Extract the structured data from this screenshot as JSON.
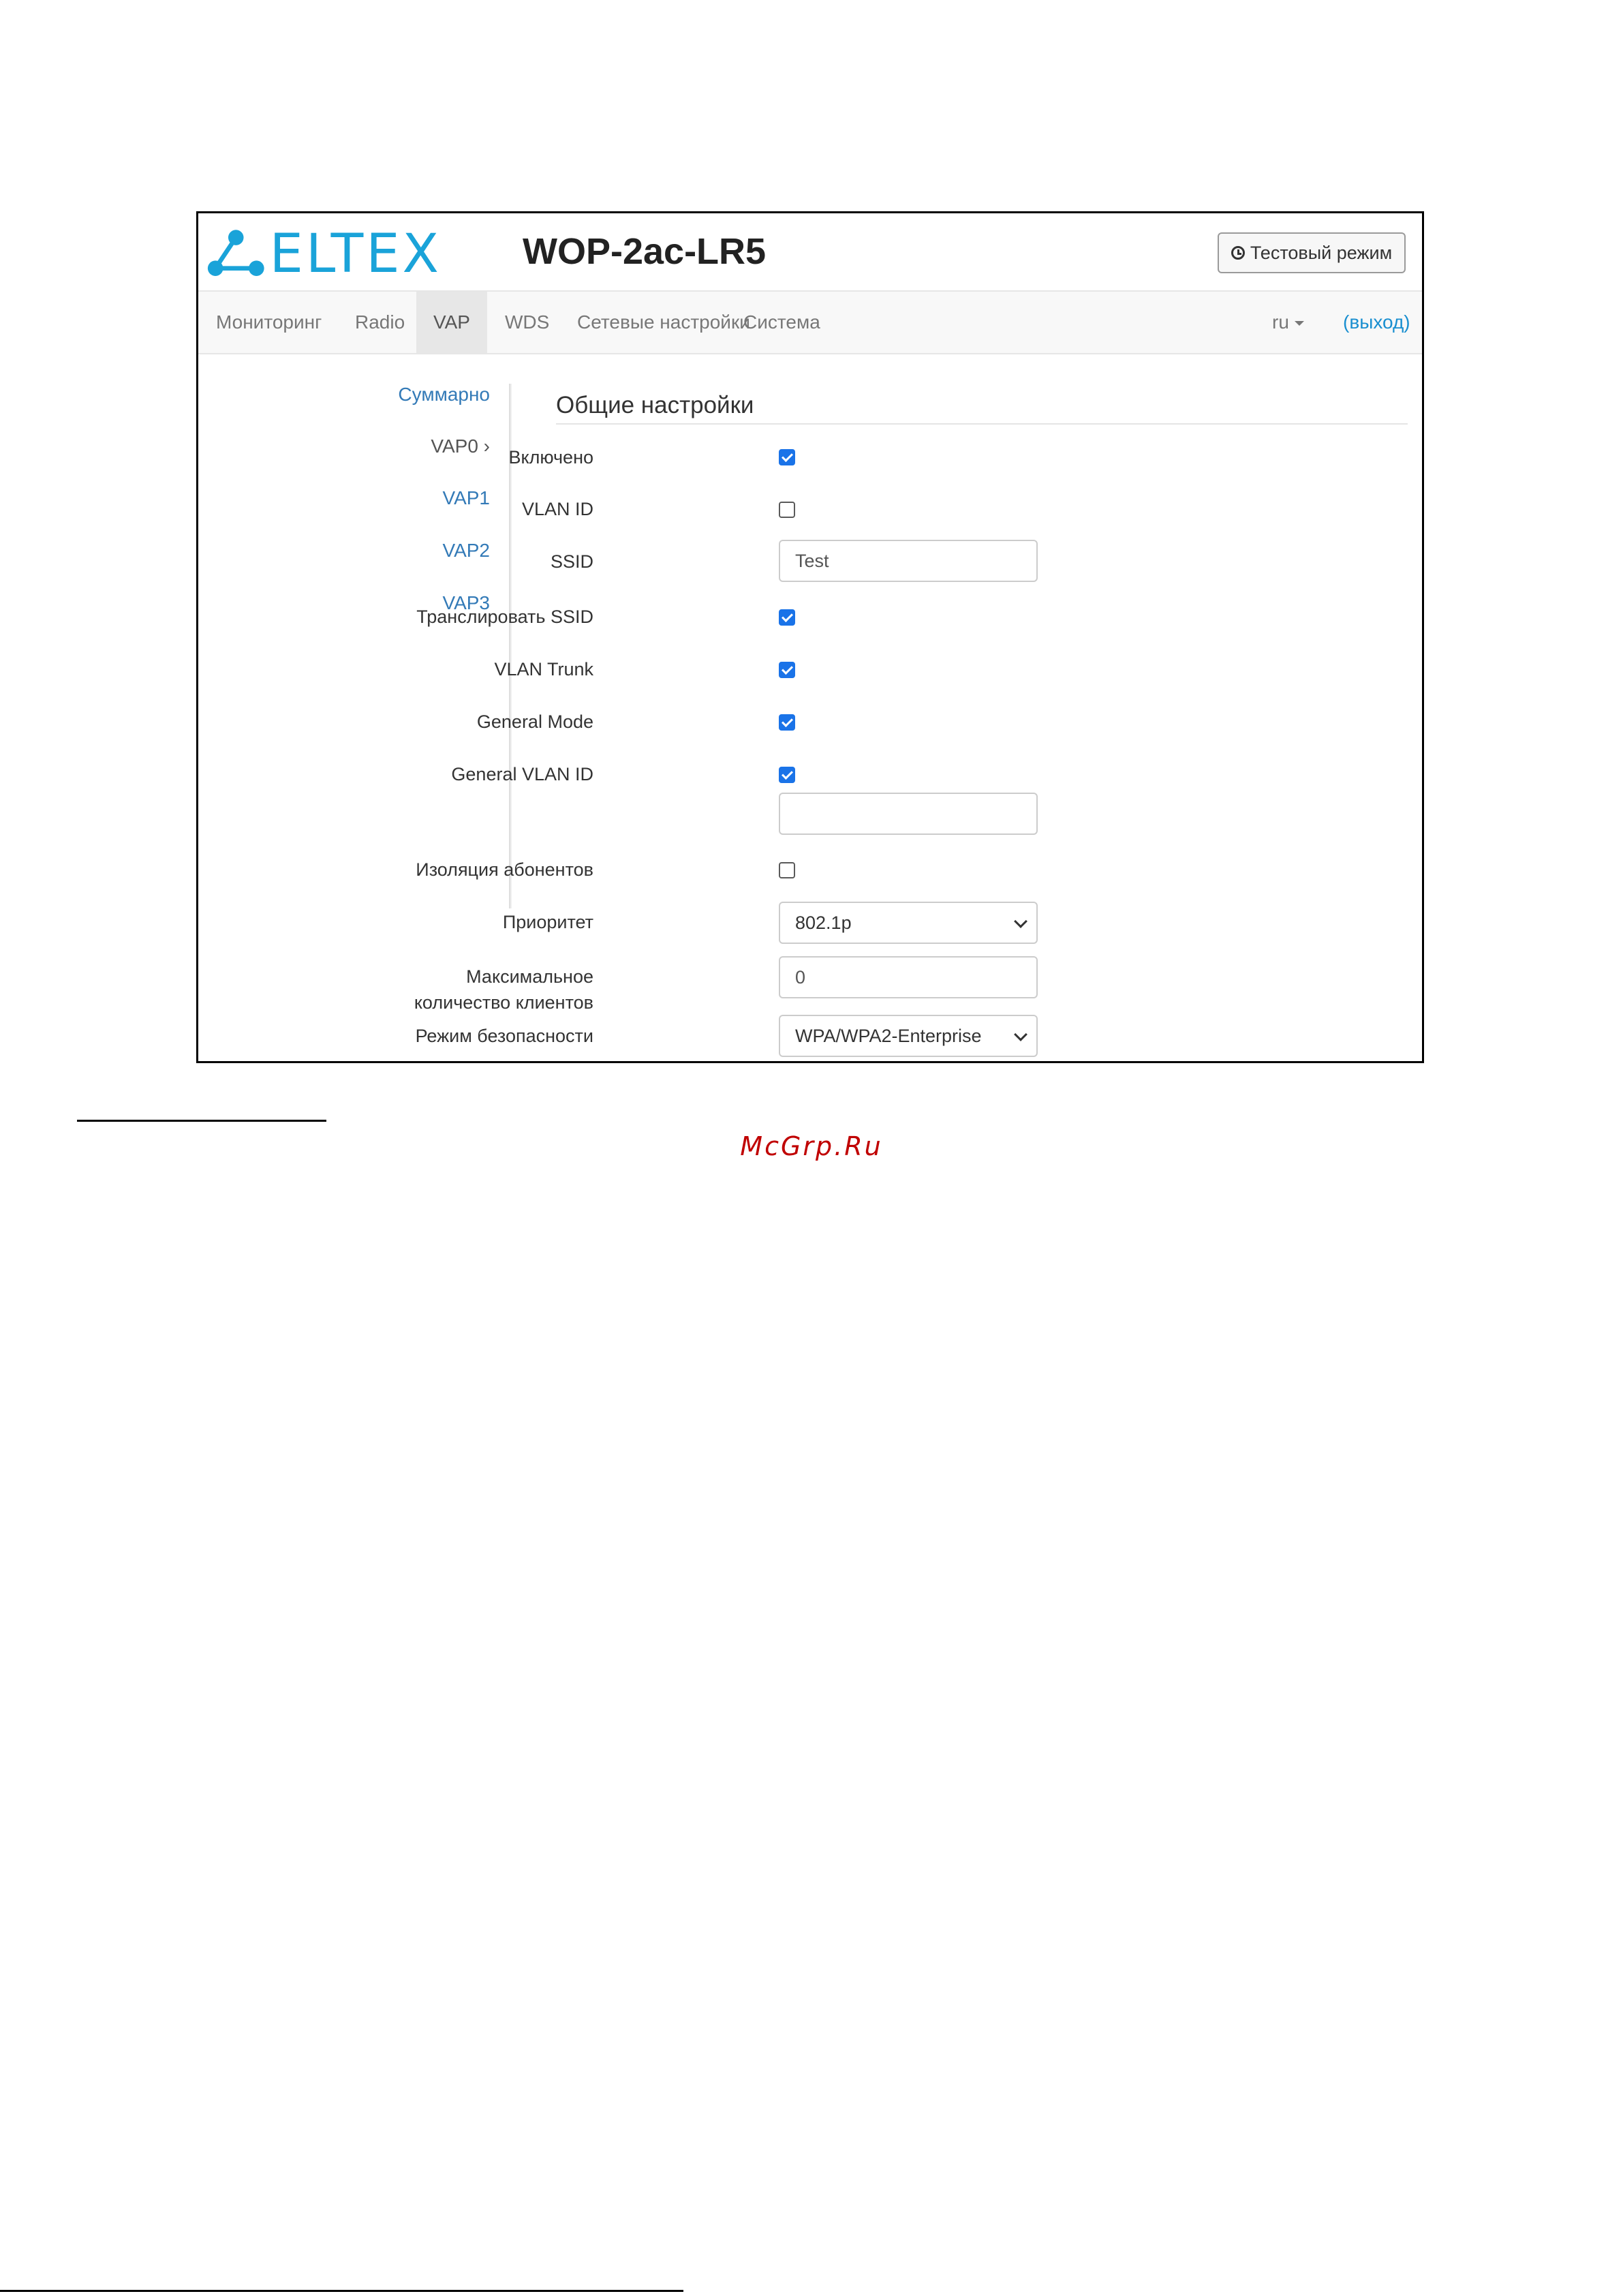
{
  "header": {
    "logo_text": "ELTEX",
    "device_title": "WOP-2ac-LR5",
    "test_mode_button": "Тестовый режим"
  },
  "nav": {
    "items": [
      {
        "label": "Мониторинг",
        "active": false
      },
      {
        "label": "Radio",
        "active": false
      },
      {
        "label": "VAP",
        "active": true
      },
      {
        "label": "WDS",
        "active": false
      },
      {
        "label": "Сетевые настройки",
        "active": false
      },
      {
        "label": "Система",
        "active": false
      }
    ],
    "language": "ru",
    "logout": "(выход)"
  },
  "sidebar": {
    "items": [
      {
        "label": "Суммарно",
        "current": false
      },
      {
        "label": "VAP0 ›",
        "current": true
      },
      {
        "label": "VAP1",
        "current": false
      },
      {
        "label": "VAP2",
        "current": false
      },
      {
        "label": "VAP3",
        "current": false
      }
    ]
  },
  "form": {
    "section_title": "Общие настройки",
    "enabled_label": "Включено",
    "enabled_checked": true,
    "vlan_id_label": "VLAN ID",
    "vlan_id_checked": false,
    "ssid_label": "SSID",
    "ssid_value": "Test",
    "broadcast_ssid_label": "Транслировать SSID",
    "broadcast_ssid_checked": true,
    "vlan_trunk_label": "VLAN Trunk",
    "vlan_trunk_checked": true,
    "general_mode_label": "General Mode",
    "general_mode_checked": true,
    "general_vlan_id_label": "General VLAN ID",
    "general_vlan_id_checked": true,
    "general_vlan_id_value": "",
    "client_isolation_label": "Изоляция абонентов",
    "client_isolation_checked": false,
    "priority_label": "Приоритет",
    "priority_value": "802.1p",
    "max_clients_label_line1": "Максимальное",
    "max_clients_label_line2": "количество клиентов",
    "max_clients_value": "0",
    "security_mode_label": "Режим безопасности",
    "security_mode_value": "WPA/WPA2-Enterprise"
  },
  "page": {
    "watermark": "McGrp.Ru"
  },
  "colors": {
    "logo": "#1aa3d9",
    "link": "#337ab7",
    "checkbox": "#1a73e8",
    "watermark": "#c00000"
  }
}
